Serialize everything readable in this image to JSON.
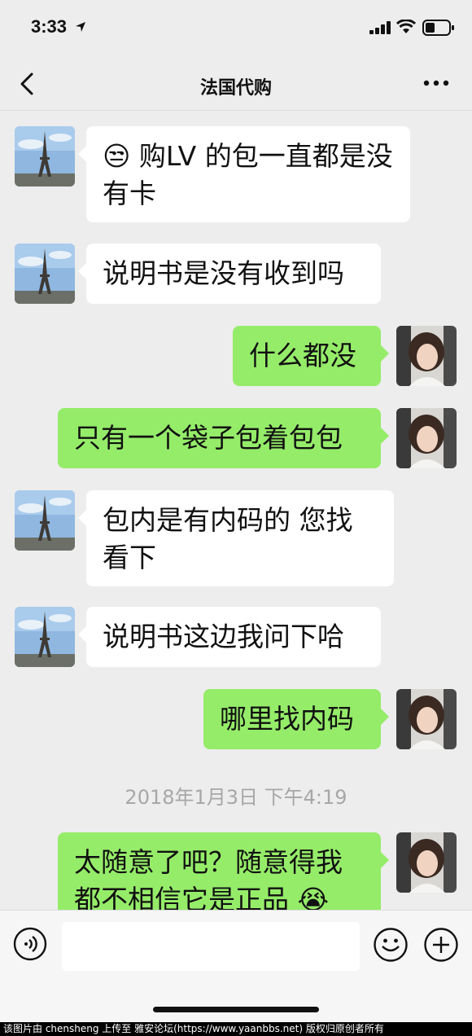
{
  "status_bar": {
    "time": "3:33"
  },
  "nav": {
    "title": "法国代购"
  },
  "messages": [
    {
      "side": "in",
      "text": "购LV 的包一直都是没有卡",
      "emoji": "😒"
    },
    {
      "side": "in",
      "text": "说明书是没有收到吗"
    },
    {
      "side": "out",
      "text": "什么都没"
    },
    {
      "side": "out",
      "text": "只有一个袋子包着包包"
    },
    {
      "side": "in",
      "text": "包内是有内码的 您找看下"
    },
    {
      "side": "in",
      "text": "说明书这边我问下哈"
    },
    {
      "side": "out",
      "text": "哪里找内码"
    },
    {
      "side": "out",
      "text": "太随意了吧？随意得我都不相信它是正品",
      "emoji": "😭"
    }
  ],
  "timestamp": "2018年1月3日 下午4:19",
  "watermark": "该图片由 chensheng 上传至 雅安论坛(https://www.yaanbbs.net) 版权归原创者所有",
  "colors": {
    "outgoing_bubble": "#95ec69",
    "incoming_bubble": "#ffffff",
    "background": "#ededed"
  }
}
